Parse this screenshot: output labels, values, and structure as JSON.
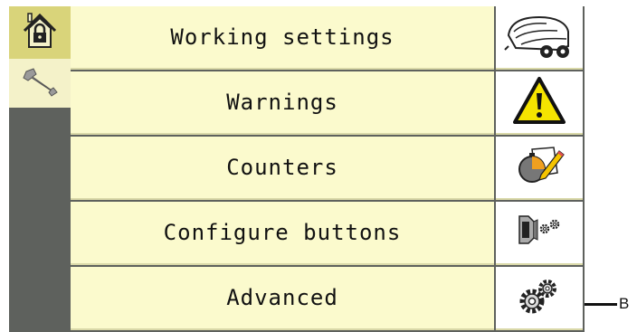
{
  "sidebar": {
    "tabs": [
      {
        "icon": "home-lock-icon",
        "selected": true
      },
      {
        "icon": "wrench-icon",
        "selected": false
      }
    ]
  },
  "menu": {
    "items": [
      {
        "label": "Working settings",
        "icon": "baler-icon"
      },
      {
        "label": "Warnings",
        "icon": "warning-icon"
      },
      {
        "label": "Counters",
        "icon": "stopwatch-pencil-icon"
      },
      {
        "label": "Configure buttons",
        "icon": "button-gears-icon"
      },
      {
        "label": "Advanced",
        "icon": "gears-icon"
      }
    ]
  },
  "callout": {
    "label": "B"
  },
  "colors": {
    "row_background": "#fbfacd",
    "selected_tab": "#d9d47a",
    "frame": "#5e615d",
    "warning_yellow": "#f5e400"
  }
}
